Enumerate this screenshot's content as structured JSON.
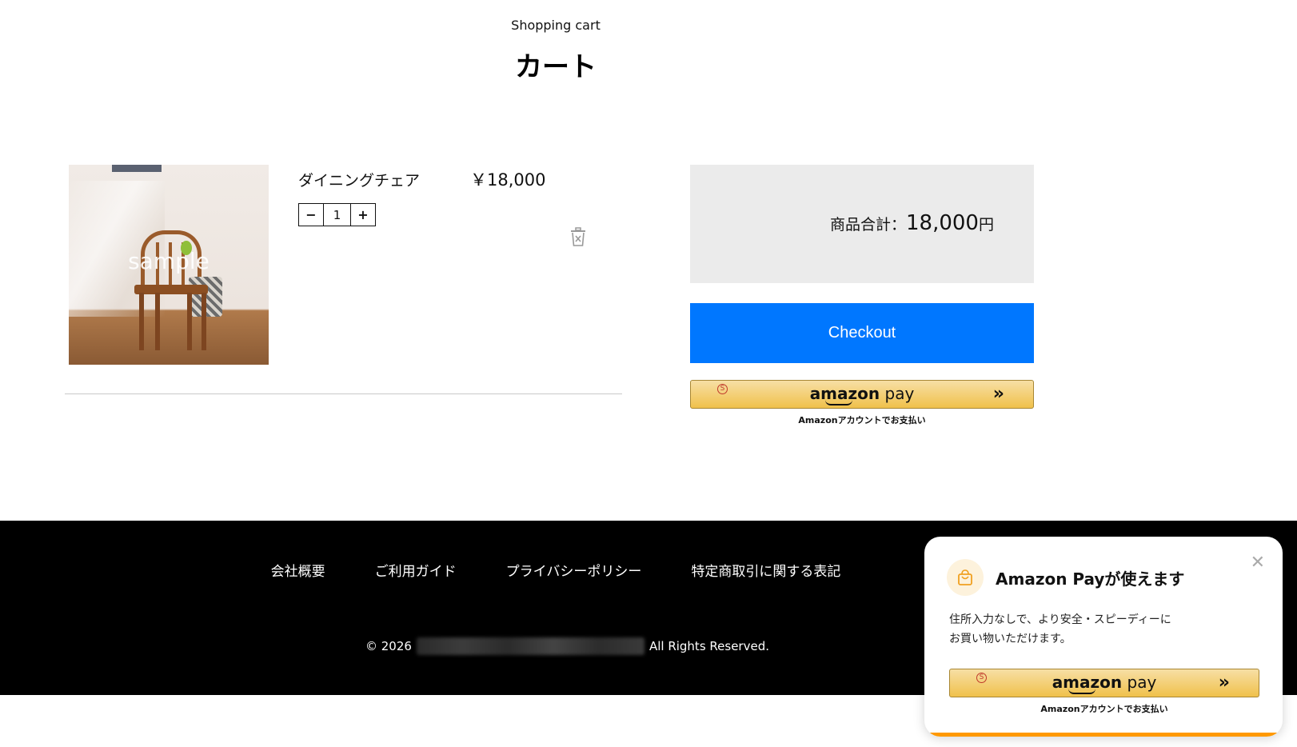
{
  "header": {
    "subtitle": "Shopping cart",
    "title": "カート"
  },
  "cart": {
    "items": [
      {
        "image_watermark": "sample",
        "name": "ダイニングチェア",
        "price": "￥18,000",
        "quantity": "1",
        "decrement_label": "−",
        "increment_label": "+"
      }
    ]
  },
  "summary": {
    "label": "商品合計：",
    "amount": "18,000",
    "currency": "円"
  },
  "checkout": {
    "label": "Checkout",
    "color": "#0077ff"
  },
  "amazon_pay": {
    "badge": "S",
    "logo_prefix": "amazon",
    "logo_suffix": "pay",
    "arrow": "»",
    "caption": "Amazonアカウントでお支払い",
    "colors": {
      "top": "#f7dfa5",
      "bottom": "#f0c14b",
      "border": "#a88734"
    }
  },
  "footer": {
    "links": [
      "会社概要",
      "ご利用ガイド",
      "プライバシーポリシー",
      "特定商取引に関する表記"
    ],
    "copyright_prefix": "© 2026",
    "copyright_suffix": "All Rights Reserved."
  },
  "popup": {
    "heading": "Amazon Payが使えます",
    "close": "✕",
    "description_line1": "住所入力なしで、より安全・スピーディーに",
    "description_line2": "お買い物いただけます。",
    "accent_color": "#ff9900"
  }
}
